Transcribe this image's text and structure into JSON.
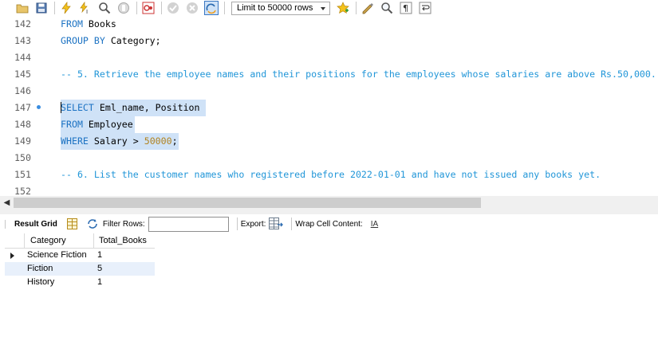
{
  "toolbar": {
    "limit_label": "Limit to 50000 rows",
    "buttons": [
      "open-folder-icon",
      "save-icon",
      "execute-icon",
      "execute-current-icon",
      "explain-icon",
      "stop-icon",
      "toggle-errors-icon",
      "commit-icon",
      "rollback-icon",
      "autocommit-icon",
      "bookmark-icon",
      "beautify-icon",
      "find-icon",
      "invisible-chars-icon",
      "wrap-icon"
    ]
  },
  "editor": {
    "lines": [
      {
        "num": "142",
        "text": "FROM Books"
      },
      {
        "num": "143",
        "text": "GROUP BY Category;"
      },
      {
        "num": "144",
        "text": ""
      },
      {
        "num": "145",
        "text": "-- 5. Retrieve the employee names and their positions for the employees whose salaries are above Rs.50,000."
      },
      {
        "num": "146",
        "text": ""
      },
      {
        "num": "147",
        "text": "SELECT Eml_name, Position"
      },
      {
        "num": "148",
        "text": "FROM Employee"
      },
      {
        "num": "149",
        "text": "WHERE Salary > 50000;"
      },
      {
        "num": "150",
        "text": ""
      },
      {
        "num": "151",
        "text": "-- 6. List the customer names who registered before 2022-01-01 and have not issued any books yet."
      },
      {
        "num": "152",
        "text": ""
      }
    ],
    "tokens": {
      "l142_kw": "FROM",
      "l142_rest": " Books",
      "l143_kw": "GROUP BY",
      "l143_rest": " Category;",
      "l145_cm": "-- 5. Retrieve the employee names and their positions for the employees whose salaries are above Rs.50,000.",
      "l147_kw": "SELECT",
      "l147_rest": " Eml_name, Position",
      "l148_kw": "FROM",
      "l148_rest": " Employee",
      "l149_kw": "WHERE",
      "l149_rest": " Salary > ",
      "l149_num": "50000",
      "l149_end": ";",
      "l151_cm": "-- 6. List the customer names who registered before 2022-01-01 and have not issued any books yet."
    }
  },
  "result": {
    "tab_label": "Result Grid",
    "filter_label": "Filter Rows:",
    "filter_value": "",
    "export_label": "Export:",
    "wrap_label": "Wrap Cell Content:",
    "wrap_icon_text": "IA",
    "columns": [
      "Category",
      "Total_Books"
    ],
    "rows": [
      {
        "category": "Science Fiction",
        "total": "1"
      },
      {
        "category": "Fiction",
        "total": "5"
      },
      {
        "category": "History",
        "total": "1"
      }
    ]
  },
  "colors": {
    "keyword": "#1d73c3",
    "comment": "#2196d8",
    "number": "#b0821f",
    "selection": "#cfe2f7"
  }
}
